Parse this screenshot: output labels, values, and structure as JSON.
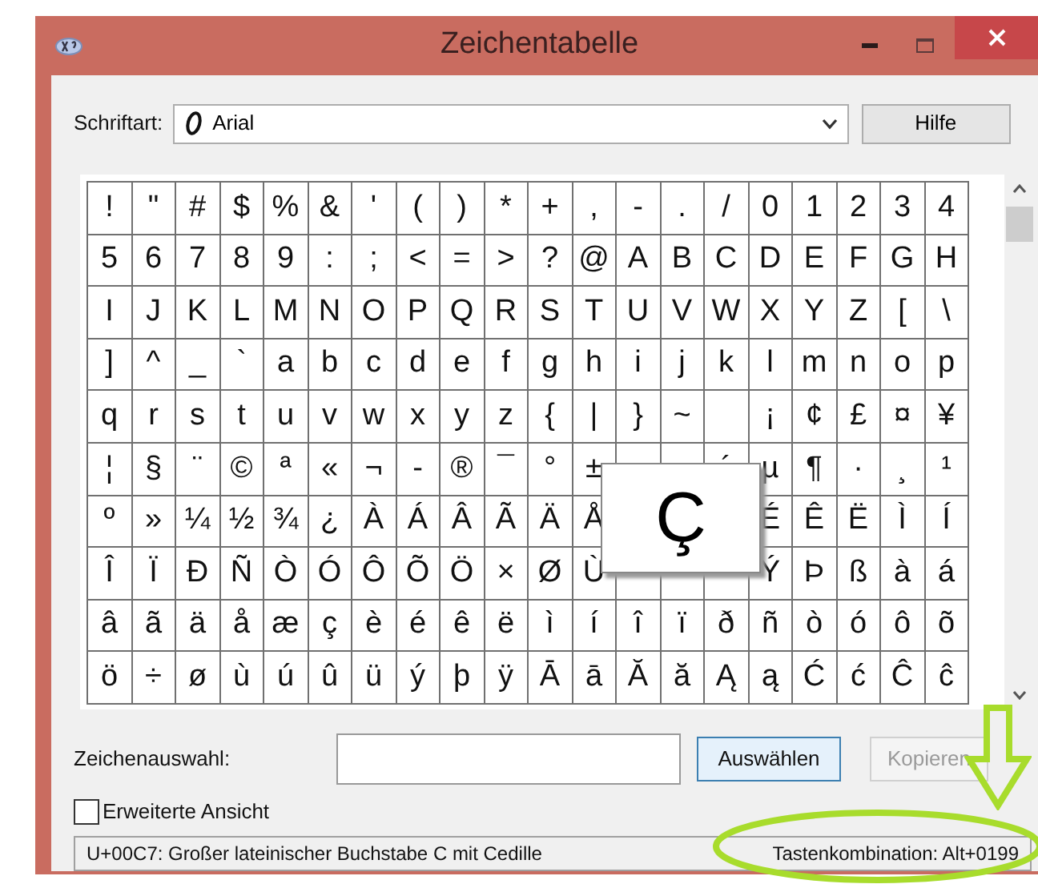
{
  "window": {
    "title": "Zeichentabelle"
  },
  "font": {
    "label": "Schriftart:",
    "value": "Arial"
  },
  "help_button": {
    "label": "Hilfe"
  },
  "grid": {
    "rows": [
      [
        "!",
        "\"",
        "#",
        "$",
        "%",
        "&",
        "'",
        "(",
        ")",
        "*",
        "+",
        ",",
        "-",
        ".",
        "/",
        "0",
        "1",
        "2",
        "3",
        "4"
      ],
      [
        "5",
        "6",
        "7",
        "8",
        "9",
        ":",
        ";",
        "<",
        "=",
        ">",
        "?",
        "@",
        "A",
        "B",
        "C",
        "D",
        "E",
        "F",
        "G",
        "H"
      ],
      [
        "I",
        "J",
        "K",
        "L",
        "M",
        "N",
        "O",
        "P",
        "Q",
        "R",
        "S",
        "T",
        "U",
        "V",
        "W",
        "X",
        "Y",
        "Z",
        "[",
        "\\"
      ],
      [
        "]",
        "^",
        "_",
        "`",
        "a",
        "b",
        "c",
        "d",
        "e",
        "f",
        "g",
        "h",
        "i",
        "j",
        "k",
        "l",
        "m",
        "n",
        "o",
        "p"
      ],
      [
        "q",
        "r",
        "s",
        "t",
        "u",
        "v",
        "w",
        "x",
        "y",
        "z",
        "{",
        "|",
        "}",
        "~",
        null,
        "¡",
        "¢",
        "£",
        "¤",
        "¥"
      ],
      [
        "¦",
        "§",
        "¨",
        "©",
        "ª",
        "«",
        "¬",
        "-",
        "®",
        "¯",
        "°",
        "±",
        null,
        null,
        "´",
        "µ",
        "¶",
        "·",
        "¸",
        "¹"
      ],
      [
        "º",
        "»",
        "¼",
        "½",
        "¾",
        "¿",
        "À",
        "Á",
        "Â",
        "Ã",
        "Ä",
        "Å",
        null,
        null,
        null,
        "É",
        "Ê",
        "Ë",
        "Ì",
        "Í"
      ],
      [
        "Î",
        "Ï",
        "Ð",
        "Ñ",
        "Ò",
        "Ó",
        "Ô",
        "Õ",
        "Ö",
        "×",
        "Ø",
        "Ù",
        null,
        null,
        null,
        "Ý",
        "Þ",
        "ß",
        "à",
        "á"
      ],
      [
        "â",
        "ã",
        "ä",
        "å",
        "æ",
        "ç",
        "è",
        "é",
        "ê",
        "ë",
        "ì",
        "í",
        "î",
        "ï",
        "ð",
        "ñ",
        "ò",
        "ó",
        "ô",
        "õ"
      ],
      [
        "ö",
        "÷",
        "ø",
        "ù",
        "ú",
        "û",
        "ü",
        "ý",
        "þ",
        "ÿ",
        "Ā",
        "ā",
        "Ă",
        "ă",
        "Ą",
        "ą",
        "Ć",
        "ć",
        "Ĉ",
        "ĉ"
      ]
    ]
  },
  "magnified": "Ç",
  "selection": {
    "label": "Zeichenauswahl:"
  },
  "buttons": [
    {
      "label": "Auswählen",
      "disabled": false
    },
    {
      "label": "Kopieren",
      "disabled": true
    }
  ],
  "advanced_view": {
    "label": "Erweiterte Ansicht",
    "checked": false
  },
  "status_bar": {
    "description": "U+00C7: Großer lateinischer Buchstabe C mit Cedille",
    "keystroke": "Tastenkombination: Alt+0199"
  }
}
